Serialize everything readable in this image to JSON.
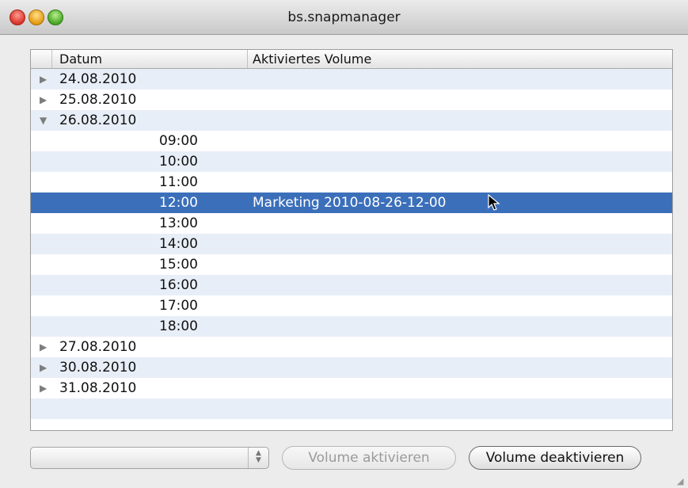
{
  "window": {
    "title": "bs.snapmanager"
  },
  "table": {
    "columns": {
      "datum": "Datum",
      "volume": "Aktiviertes Volume"
    },
    "rows": [
      {
        "type": "date",
        "expanded": false,
        "label": "24.08.2010",
        "volume": ""
      },
      {
        "type": "date",
        "expanded": false,
        "label": "25.08.2010",
        "volume": ""
      },
      {
        "type": "date",
        "expanded": true,
        "label": "26.08.2010",
        "volume": ""
      },
      {
        "type": "time",
        "label": "09:00",
        "volume": ""
      },
      {
        "type": "time",
        "label": "10:00",
        "volume": ""
      },
      {
        "type": "time",
        "label": "11:00",
        "volume": ""
      },
      {
        "type": "time",
        "label": "12:00",
        "volume": "Marketing 2010-08-26-12-00",
        "selected": true
      },
      {
        "type": "time",
        "label": "13:00",
        "volume": ""
      },
      {
        "type": "time",
        "label": "14:00",
        "volume": ""
      },
      {
        "type": "time",
        "label": "15:00",
        "volume": ""
      },
      {
        "type": "time",
        "label": "16:00",
        "volume": ""
      },
      {
        "type": "time",
        "label": "17:00",
        "volume": ""
      },
      {
        "type": "time",
        "label": "18:00",
        "volume": ""
      },
      {
        "type": "date",
        "expanded": false,
        "label": "27.08.2010",
        "volume": ""
      },
      {
        "type": "date",
        "expanded": false,
        "label": "30.08.2010",
        "volume": ""
      },
      {
        "type": "date",
        "expanded": false,
        "label": "31.08.2010",
        "volume": ""
      },
      {
        "type": "empty",
        "label": "",
        "volume": ""
      },
      {
        "type": "empty",
        "label": "",
        "volume": ""
      }
    ]
  },
  "controls": {
    "popup_value": "",
    "activate_label": "Volume aktivieren",
    "deactivate_label": "Volume deaktivieren"
  },
  "icons": {
    "collapsed": "disclosure-triangle-right",
    "expanded": "disclosure-triangle-down",
    "cursor": "mouse-pointer"
  }
}
